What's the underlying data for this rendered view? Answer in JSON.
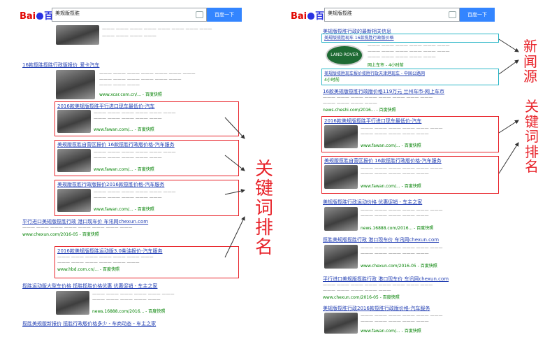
{
  "query": "美规版揽胜",
  "search_button": "百度一下",
  "brand": {
    "bai": "Bai",
    "du": "百度"
  },
  "labels": {
    "left_keyword": "关键词排名",
    "right_news": "新闻源",
    "right_keyword": "关键词排名"
  },
  "left_results": [
    {
      "title": "16款揽胜揽胜行政版报价_爱卡汽车",
      "url": "www.xcar.com.cn/... - 百度快照"
    },
    {
      "title": "2016款美规版揽胜平行进口现车最低价-汽车",
      "url": "www.fawan.com/... - 百度快照"
    },
    {
      "title": "美规版揽胜自营区报价 16款揽胜行政版价格-汽车服务",
      "url": "www.fawan.com/... - 百度快照"
    },
    {
      "title": "美规版揽胜行政版报价2016款揽胜价格-汽车服务",
      "url": "www.fawan.com/... - 百度快照"
    },
    {
      "title": "平行进口美规版揽胜行政 港口现车价 车讯网chexun.com",
      "url": "www.chexun.com/2016-05 - 百度快照"
    },
    {
      "title": "2016款美规版揽胜运动版3.0柴油报价-汽车服务",
      "url": "www.hbd.com.cn/... - 百度快照"
    },
    {
      "title": "揽胜运动版大型车价格 揽胜揽胜价格优惠 优惠促销 - 车主之家",
      "url": "news.16888.com/2016... - 百度快照"
    },
    {
      "title": "揽胜美规版新报价 揽胜行政版价格多少 - 车商动态 - 车主之家",
      "url": ""
    }
  ],
  "right_results": [
    {
      "title": "美规版揽胜行政的最新相关信息",
      "url": ""
    },
    {
      "title": "美规版揽胜现车 16款揽胜行政版价格",
      "url": "网上车市 - 4小时前"
    },
    {
      "title": "美规版揽胜现车报价揽胜行政天津港现车 - 中国公路网",
      "url": "4小时前"
    },
    {
      "title": "16款美规版揽胜行政版价格119万元 兰州车市-网上车市",
      "url": "news.cheshi.com/2016... - 百度快照"
    },
    {
      "title": "2016款美规版揽胜平行进口现车最低价-汽车",
      "url": "www.fawan.com/... - 百度快照"
    },
    {
      "title": "美规版揽胜自营区报价 16款揽胜行政版价格-汽车服务",
      "url": "www.fawan.com/... - 百度快照"
    },
    {
      "title": "美规版揽胜行政运动价格 优惠促销 - 车主之家",
      "url": "news.16888.com/2016... - 百度快照"
    },
    {
      "title": "揽胜美规版揽胜行政 港口现车价 车讯网chexun.com",
      "url": "www.chexun.com/2016-05 - 百度快照"
    },
    {
      "title": "平行进口美规版揽胜行政 港口现车价 车讯网chexun.com",
      "url": "www.chexun.com/2016-05 - 百度快照"
    },
    {
      "title": "美规版揽胜行政2016款揽胜行政版价格-汽车服务",
      "url": "www.fawan.com/... - 百度快照"
    }
  ],
  "land_rover": "LAND ROVER"
}
